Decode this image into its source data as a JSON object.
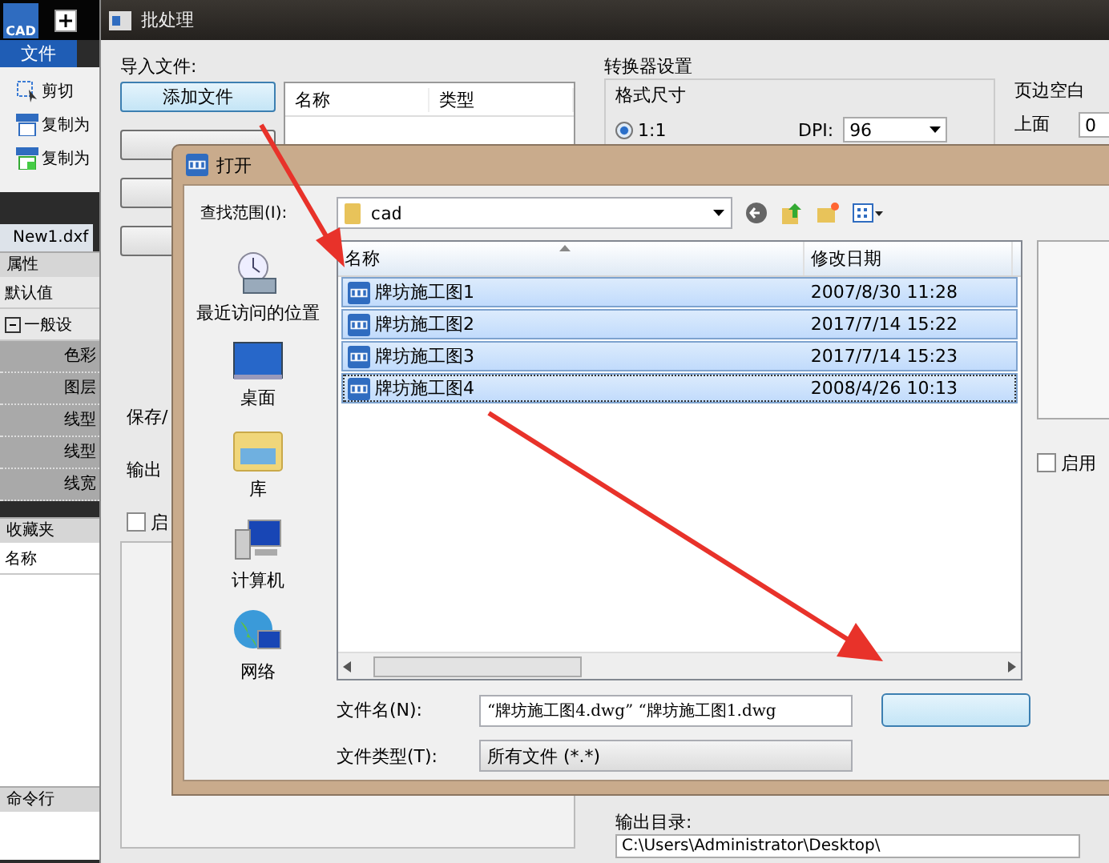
{
  "app": {
    "logo_text": "CAD",
    "menu_tab": "文件",
    "ribbon_items": [
      {
        "kind": "crop",
        "label": "剪切"
      },
      {
        "kind": "emf",
        "label": "复制为"
      },
      {
        "kind": "bmp",
        "label": "复制为"
      }
    ],
    "doc_tab": "New1.dxf",
    "properties": {
      "title": "属性",
      "defaults": "默认值",
      "group": {
        "label": "一般设",
        "expanded": true,
        "children": [
          {
            "label": "色彩"
          },
          {
            "label": "图层"
          },
          {
            "label": "线型"
          },
          {
            "label": "线型"
          },
          {
            "label": "线宽"
          }
        ]
      }
    },
    "favorites": {
      "title": "收藏夹",
      "column": "名称"
    },
    "command_line": {
      "title": "命令行"
    }
  },
  "batch": {
    "title": "批处理",
    "import_label": "导入文件:",
    "add_file_button": "添加文件",
    "list_columns": [
      "名称",
      "类型"
    ],
    "save_label": "保存/",
    "output_format_label": "输出",
    "enable_checkbox": {
      "label": "启",
      "checked": false
    },
    "converter": {
      "title": "转换器设置",
      "format_size": "格式尺寸",
      "scale_option": {
        "label": "1:1",
        "selected": true
      },
      "dpi_label": "DPI:",
      "dpi_value": "96"
    },
    "margins": {
      "title": "页边空白",
      "top_label": "上面",
      "top_value": "0"
    },
    "output_dir": {
      "label": "输出目录:",
      "value": "C:\\Users\\Administrator\\Desktop\\"
    }
  },
  "open_dialog": {
    "title": "打开",
    "look_in_label": "查找范围(I):",
    "look_in_value": "cad",
    "places": [
      {
        "kind": "recent",
        "label": "最近访问的位置"
      },
      {
        "kind": "desktop",
        "label": "桌面"
      },
      {
        "kind": "library",
        "label": "库"
      },
      {
        "kind": "computer",
        "label": "计算机"
      },
      {
        "kind": "network",
        "label": "网络"
      }
    ],
    "columns": [
      "名称",
      "修改日期"
    ],
    "files": [
      {
        "name": "牌坊施工图1",
        "modified": "2007/8/30 11:28",
        "selected": true,
        "focused": false
      },
      {
        "name": "牌坊施工图2",
        "modified": "2017/7/14 15:22",
        "selected": true,
        "focused": false
      },
      {
        "name": "牌坊施工图3",
        "modified": "2017/7/14 15:23",
        "selected": true,
        "focused": false
      },
      {
        "name": "牌坊施工图4",
        "modified": "2008/4/26 10:13",
        "selected": true,
        "focused": true
      }
    ],
    "file_name_label": "文件名(N):",
    "file_name_value": "“牌坊施工图4.dwg” “牌坊施工图1.dwg",
    "file_type_label": "文件类型(T):",
    "file_type_value": "所有文件 (*.*)",
    "preview_checkbox": {
      "label": "启用",
      "checked": false
    }
  }
}
